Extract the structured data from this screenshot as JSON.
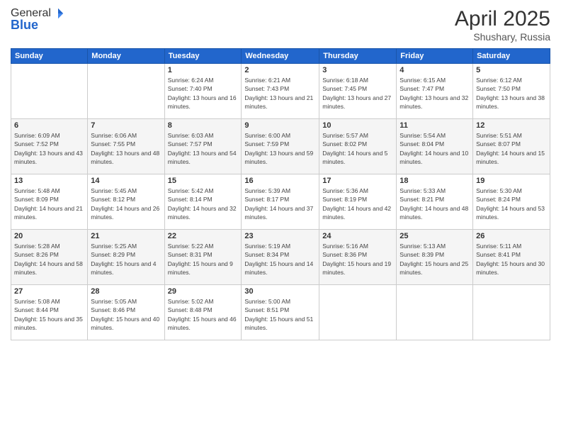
{
  "header": {
    "logo_general": "General",
    "logo_blue": "Blue",
    "month_title": "April 2025",
    "location": "Shushary, Russia"
  },
  "weekdays": [
    "Sunday",
    "Monday",
    "Tuesday",
    "Wednesday",
    "Thursday",
    "Friday",
    "Saturday"
  ],
  "weeks": [
    [
      {
        "day": "",
        "info": ""
      },
      {
        "day": "",
        "info": ""
      },
      {
        "day": "1",
        "info": "Sunrise: 6:24 AM\nSunset: 7:40 PM\nDaylight: 13 hours and 16 minutes."
      },
      {
        "day": "2",
        "info": "Sunrise: 6:21 AM\nSunset: 7:43 PM\nDaylight: 13 hours and 21 minutes."
      },
      {
        "day": "3",
        "info": "Sunrise: 6:18 AM\nSunset: 7:45 PM\nDaylight: 13 hours and 27 minutes."
      },
      {
        "day": "4",
        "info": "Sunrise: 6:15 AM\nSunset: 7:47 PM\nDaylight: 13 hours and 32 minutes."
      },
      {
        "day": "5",
        "info": "Sunrise: 6:12 AM\nSunset: 7:50 PM\nDaylight: 13 hours and 38 minutes."
      }
    ],
    [
      {
        "day": "6",
        "info": "Sunrise: 6:09 AM\nSunset: 7:52 PM\nDaylight: 13 hours and 43 minutes."
      },
      {
        "day": "7",
        "info": "Sunrise: 6:06 AM\nSunset: 7:55 PM\nDaylight: 13 hours and 48 minutes."
      },
      {
        "day": "8",
        "info": "Sunrise: 6:03 AM\nSunset: 7:57 PM\nDaylight: 13 hours and 54 minutes."
      },
      {
        "day": "9",
        "info": "Sunrise: 6:00 AM\nSunset: 7:59 PM\nDaylight: 13 hours and 59 minutes."
      },
      {
        "day": "10",
        "info": "Sunrise: 5:57 AM\nSunset: 8:02 PM\nDaylight: 14 hours and 5 minutes."
      },
      {
        "day": "11",
        "info": "Sunrise: 5:54 AM\nSunset: 8:04 PM\nDaylight: 14 hours and 10 minutes."
      },
      {
        "day": "12",
        "info": "Sunrise: 5:51 AM\nSunset: 8:07 PM\nDaylight: 14 hours and 15 minutes."
      }
    ],
    [
      {
        "day": "13",
        "info": "Sunrise: 5:48 AM\nSunset: 8:09 PM\nDaylight: 14 hours and 21 minutes."
      },
      {
        "day": "14",
        "info": "Sunrise: 5:45 AM\nSunset: 8:12 PM\nDaylight: 14 hours and 26 minutes."
      },
      {
        "day": "15",
        "info": "Sunrise: 5:42 AM\nSunset: 8:14 PM\nDaylight: 14 hours and 32 minutes."
      },
      {
        "day": "16",
        "info": "Sunrise: 5:39 AM\nSunset: 8:17 PM\nDaylight: 14 hours and 37 minutes."
      },
      {
        "day": "17",
        "info": "Sunrise: 5:36 AM\nSunset: 8:19 PM\nDaylight: 14 hours and 42 minutes."
      },
      {
        "day": "18",
        "info": "Sunrise: 5:33 AM\nSunset: 8:21 PM\nDaylight: 14 hours and 48 minutes."
      },
      {
        "day": "19",
        "info": "Sunrise: 5:30 AM\nSunset: 8:24 PM\nDaylight: 14 hours and 53 minutes."
      }
    ],
    [
      {
        "day": "20",
        "info": "Sunrise: 5:28 AM\nSunset: 8:26 PM\nDaylight: 14 hours and 58 minutes."
      },
      {
        "day": "21",
        "info": "Sunrise: 5:25 AM\nSunset: 8:29 PM\nDaylight: 15 hours and 4 minutes."
      },
      {
        "day": "22",
        "info": "Sunrise: 5:22 AM\nSunset: 8:31 PM\nDaylight: 15 hours and 9 minutes."
      },
      {
        "day": "23",
        "info": "Sunrise: 5:19 AM\nSunset: 8:34 PM\nDaylight: 15 hours and 14 minutes."
      },
      {
        "day": "24",
        "info": "Sunrise: 5:16 AM\nSunset: 8:36 PM\nDaylight: 15 hours and 19 minutes."
      },
      {
        "day": "25",
        "info": "Sunrise: 5:13 AM\nSunset: 8:39 PM\nDaylight: 15 hours and 25 minutes."
      },
      {
        "day": "26",
        "info": "Sunrise: 5:11 AM\nSunset: 8:41 PM\nDaylight: 15 hours and 30 minutes."
      }
    ],
    [
      {
        "day": "27",
        "info": "Sunrise: 5:08 AM\nSunset: 8:44 PM\nDaylight: 15 hours and 35 minutes."
      },
      {
        "day": "28",
        "info": "Sunrise: 5:05 AM\nSunset: 8:46 PM\nDaylight: 15 hours and 40 minutes."
      },
      {
        "day": "29",
        "info": "Sunrise: 5:02 AM\nSunset: 8:48 PM\nDaylight: 15 hours and 46 minutes."
      },
      {
        "day": "30",
        "info": "Sunrise: 5:00 AM\nSunset: 8:51 PM\nDaylight: 15 hours and 51 minutes."
      },
      {
        "day": "",
        "info": ""
      },
      {
        "day": "",
        "info": ""
      },
      {
        "day": "",
        "info": ""
      }
    ]
  ]
}
